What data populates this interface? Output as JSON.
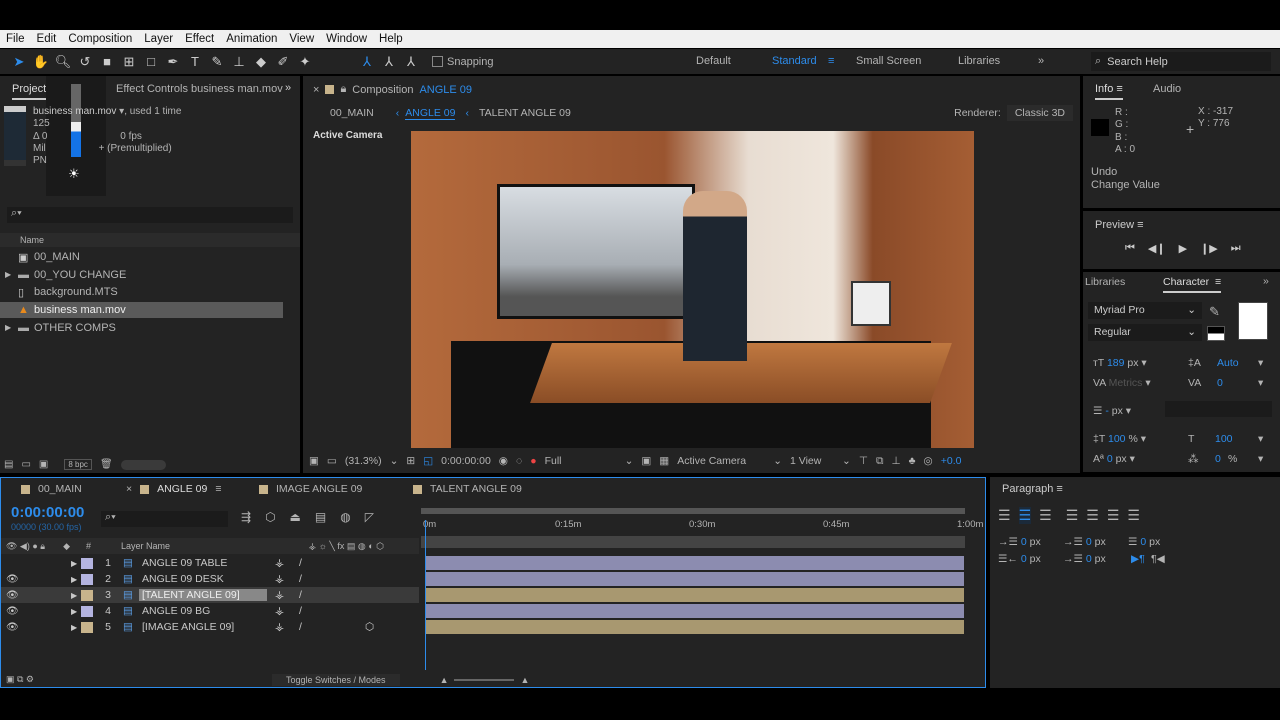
{
  "menu": [
    "File",
    "Edit",
    "Composition",
    "Layer",
    "Effect",
    "Animation",
    "View",
    "Window",
    "Help"
  ],
  "toolbar": {
    "snapping": "Snapping",
    "workspaces": [
      "Default",
      "Standard",
      "Small Screen",
      "Libraries"
    ],
    "active_workspace": "Standard",
    "search_placeholder": "Search Help"
  },
  "project": {
    "tab": "Project",
    "effect_tab": "Effect Controls business man.mov",
    "item_name": "business man.mov",
    "used": ", used 1 time",
    "line2": "125",
    "line3": "Δ 0",
    "fps": "0 fps",
    "line4": "Mil",
    "premult": "+ (Premultiplied)",
    "line5": "PN",
    "col_name": "Name",
    "items": [
      {
        "name": "00_MAIN",
        "type": "comp"
      },
      {
        "name": "00_YOU CHANGE",
        "type": "folder"
      },
      {
        "name": "background.MTS",
        "type": "file"
      },
      {
        "name": "business man.mov",
        "type": "file",
        "selected": true
      },
      {
        "name": "OTHER COMPS",
        "type": "folder"
      }
    ],
    "bpc": "8 bpc"
  },
  "comp": {
    "tab_prefix": "Composition",
    "tab_name": "ANGLE 09",
    "breadcrumbs": [
      "00_MAIN",
      "ANGLE 09",
      "TALENT ANGLE 09"
    ],
    "renderer_label": "Renderer:",
    "renderer": "Classic 3D",
    "view_label": "Active Camera",
    "zoom": "(31.3%)",
    "time": "0:00:00:00",
    "resolution": "Full",
    "camera": "Active Camera",
    "views": "1 View",
    "exposure": "+0.0"
  },
  "info": {
    "tab": "Info",
    "audio_tab": "Audio",
    "r": "R :",
    "g": "G :",
    "b": "B :",
    "a": "A : 0",
    "x": "X : -317",
    "y": "Y : 776",
    "undo": "Undo",
    "undo_action": "Change Value"
  },
  "preview": {
    "title": "Preview"
  },
  "character": {
    "libraries_tab": "Libraries",
    "tab": "Character",
    "font": "Myriad Pro",
    "style": "Regular",
    "size": "189",
    "size_unit": "px",
    "leading": "Auto",
    "kerning": "Metrics",
    "tracking": "0",
    "stroke": "-",
    "stroke_unit": "px",
    "vscale": "100",
    "hscale": "100",
    "pct": "%",
    "baseline": "0",
    "baseline_unit": "px",
    "tsume": "0"
  },
  "paragraph": {
    "title": "Paragraph",
    "indent_left": "0",
    "indent_first": "0",
    "space_before": "0",
    "indent_right": "0",
    "space_after": "0",
    "unit": "px"
  },
  "timeline": {
    "tabs": [
      "00_MAIN",
      "ANGLE 09",
      "IMAGE ANGLE 09",
      "TALENT ANGLE 09"
    ],
    "active_tab": "ANGLE 09",
    "timecode": "0:00:00:00",
    "frames": "00000 (30.00 fps)",
    "col_num": "#",
    "col_layer": "Layer Name",
    "ruler": [
      "0m",
      "0:15m",
      "0:30m",
      "0:45m",
      "1:00m"
    ],
    "toggle": "Toggle Switches / Modes",
    "layers": [
      {
        "num": "1",
        "name": "ANGLE 09 TABLE",
        "color": "#b4b4e0",
        "bar": "#8c8cb0",
        "visible": false
      },
      {
        "num": "2",
        "name": "ANGLE 09 DESK",
        "color": "#b4b4e0",
        "bar": "#8c8cb0",
        "visible": true
      },
      {
        "num": "3",
        "name": "[TALENT ANGLE 09]",
        "color": "#c8b48c",
        "bar": "#a89870",
        "visible": true,
        "selected": true
      },
      {
        "num": "4",
        "name": "ANGLE 09 BG",
        "color": "#b4b4e0",
        "bar": "#8c8cb0",
        "visible": true
      },
      {
        "num": "5",
        "name": "[IMAGE ANGLE 09]",
        "color": "#c8b48c",
        "bar": "#a89870",
        "visible": true
      }
    ]
  }
}
